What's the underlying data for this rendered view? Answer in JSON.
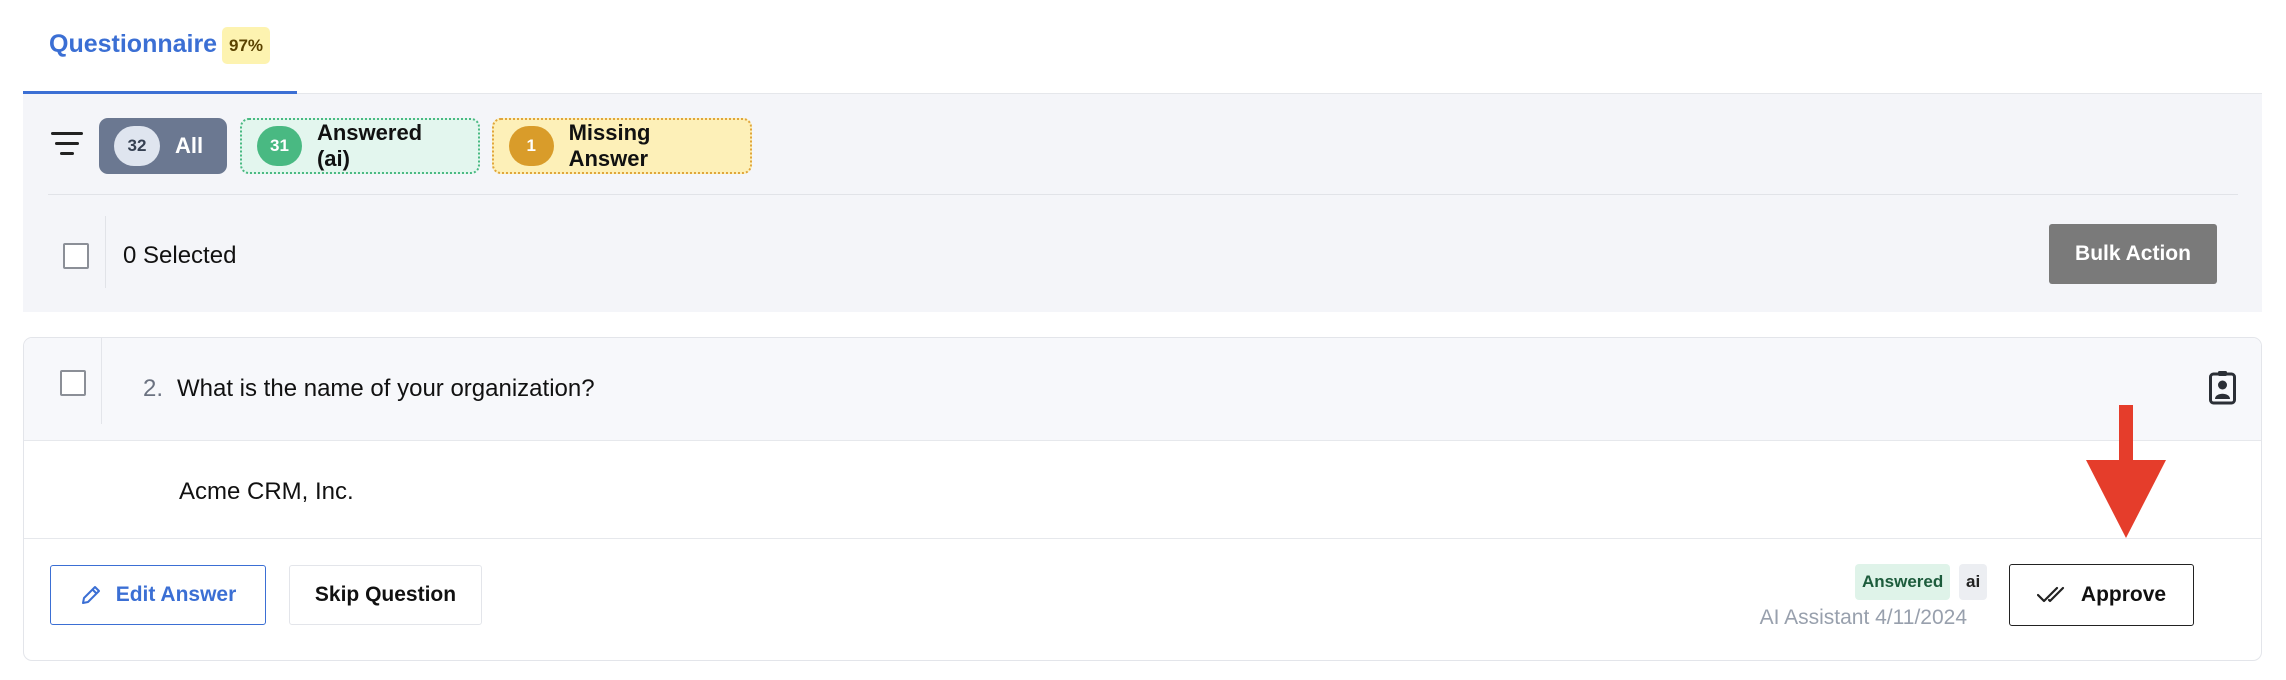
{
  "tabs": [
    {
      "label": "Questionnaire",
      "badge": "97%",
      "active": true
    }
  ],
  "filters": [
    {
      "key": "all",
      "count": "32",
      "label": "All"
    },
    {
      "key": "answered_ai",
      "count": "31",
      "label": "Answered (ai)"
    },
    {
      "key": "missing",
      "count": "1",
      "label": "Missing Answer"
    }
  ],
  "selection": {
    "text": "0 Selected",
    "bulk_label": "Bulk Action"
  },
  "question": {
    "number": "2.",
    "text": "What is the name of your organization?",
    "answer": "Acme CRM, Inc.",
    "status": "Answered",
    "source_tag": "ai",
    "meta": "AI Assistant 4/11/2024",
    "actions": {
      "edit": "Edit Answer",
      "skip": "Skip Question",
      "approve": "Approve"
    }
  },
  "icons": {
    "filter": "filter-icon",
    "contact": "contact-card-icon",
    "edit": "pencil-icon",
    "approve": "double-check-icon",
    "annotation": "red-arrow-down"
  },
  "colors": {
    "accent": "#3b6fd4",
    "chip_all": "#6b7891",
    "answered_green": "#49b982",
    "missing_amber": "#d99c2a",
    "arrow_red": "#e53d2b"
  }
}
